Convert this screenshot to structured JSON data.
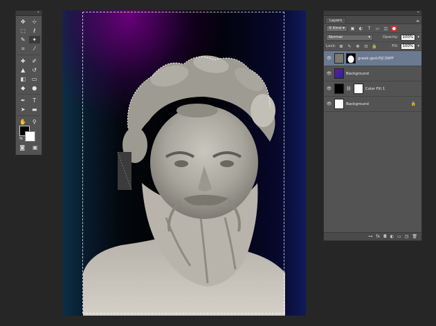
{
  "tools": {
    "items": [
      {
        "name": "move-tool-icon",
        "glyph": "✥"
      },
      {
        "name": "artboard-tool-icon",
        "glyph": "⊹"
      },
      {
        "name": "marquee-tool-icon",
        "glyph": "⬚"
      },
      {
        "name": "lasso-tool-icon",
        "glyph": "ℓ"
      },
      {
        "name": "quick-select-tool-icon",
        "glyph": "✎"
      },
      {
        "name": "magic-wand-tool-icon",
        "glyph": "✦"
      },
      {
        "name": "crop-tool-icon",
        "glyph": "⌗"
      },
      {
        "name": "eyedropper-tool-icon",
        "glyph": "⁄"
      },
      {
        "name": "healing-brush-tool-icon",
        "glyph": "✚"
      },
      {
        "name": "brush-tool-icon",
        "glyph": "✐"
      },
      {
        "name": "clone-stamp-tool-icon",
        "glyph": "▲"
      },
      {
        "name": "history-brush-tool-icon",
        "glyph": "↺"
      },
      {
        "name": "eraser-tool-icon",
        "glyph": "◧"
      },
      {
        "name": "gradient-tool-icon",
        "glyph": "▭"
      },
      {
        "name": "blur-tool-icon",
        "glyph": "◆"
      },
      {
        "name": "dodge-tool-icon",
        "glyph": "●"
      },
      {
        "name": "pen-tool-icon",
        "glyph": "✒"
      },
      {
        "name": "type-tool-icon",
        "glyph": "T"
      },
      {
        "name": "path-select-tool-icon",
        "glyph": "➤"
      },
      {
        "name": "rectangle-tool-icon",
        "glyph": "▬"
      },
      {
        "name": "hand-tool-icon",
        "glyph": "✋"
      },
      {
        "name": "zoom-tool-icon",
        "glyph": "⚲"
      }
    ],
    "swatch_mini": "⇆",
    "quick_mask": "◙",
    "screen_mode": "▣"
  },
  "layers_panel": {
    "tab_label": "Layers",
    "menu_icon": "≡",
    "filter_kind": "Kind",
    "blend_mode": "Normal",
    "opacity_label": "Opacity:",
    "opacity_value": "100%",
    "lock_label": "Lock:",
    "fill_label": "Fill:",
    "fill_value": "100%",
    "layers": [
      {
        "name": "greek-god-PJC39PF",
        "selected": true
      },
      {
        "name": "Background",
        "selected": false
      },
      {
        "name": "Color Fill 1",
        "selected": false
      },
      {
        "name": "Background",
        "selected": false,
        "locked": true
      }
    ],
    "footer_icons": [
      "⊶",
      "fx",
      "◘",
      "◐",
      "▭",
      "◳",
      "🗑"
    ]
  },
  "colors": {
    "app_bg": "#262626",
    "panel_bg": "#535353",
    "selected_layer": "#6b7a91",
    "foreground": "#000000",
    "background": "#ffffff"
  }
}
